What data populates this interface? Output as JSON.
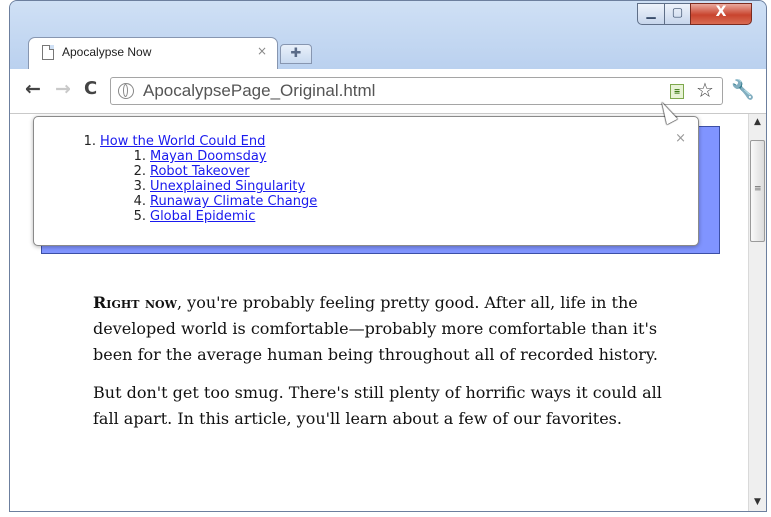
{
  "window": {
    "controls": {
      "minimize": "▁",
      "maximize": "▢",
      "close": "X"
    }
  },
  "tab": {
    "title": "Apocalypse Now",
    "close": "×",
    "new_tab": "✚"
  },
  "toolbar": {
    "back": "←",
    "forward": "→",
    "reload": "C",
    "url": "ApocalypsePage_Original.html",
    "extension_icon": "page-outline-icon",
    "star": "☆",
    "wrench": "🔧"
  },
  "popup": {
    "close": "×",
    "toc": [
      {
        "num": "1.",
        "label": "How the World Could End"
      },
      {
        "num": "1.",
        "label": "Mayan Doomsday"
      },
      {
        "num": "2.",
        "label": "Robot Takeover"
      },
      {
        "num": "3.",
        "label": "Unexplained Singularity"
      },
      {
        "num": "4.",
        "label": "Runaway Climate Change"
      },
      {
        "num": "5.",
        "label": "Global Epidemic"
      }
    ]
  },
  "article": {
    "lead": "Right now",
    "p1_rest": ", you're probably feeling pretty good. After all, life in the developed world is comfortable—probably more comfortable than it's been for the average human being throughout all of recorded history.",
    "p2": "But don't get too smug. There's still plenty of horrific ways it could all fall apart. In this article, you'll learn about a few of our favorites."
  },
  "scrollbar": {
    "up": "▲",
    "down": "▼",
    "grip": "≡"
  },
  "colors": {
    "accent_bar": "#8094ff",
    "link": "#1a1aee"
  }
}
